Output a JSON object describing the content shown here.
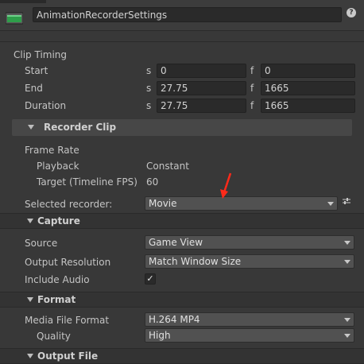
{
  "header": {
    "object_name": "AnimationRecorderSettings",
    "help_glyph": "?"
  },
  "clip_timing": {
    "title": "Clip Timing",
    "rows": [
      {
        "label": "Start",
        "s_prefix": "s",
        "s_value": "0",
        "f_prefix": "f",
        "f_value": "0"
      },
      {
        "label": "End",
        "s_prefix": "s",
        "s_value": "27.75",
        "f_prefix": "f",
        "f_value": "1665"
      },
      {
        "label": "Duration",
        "s_prefix": "s",
        "s_value": "27.75",
        "f_prefix": "f",
        "f_value": "1665"
      }
    ]
  },
  "recorder_clip": {
    "title": "Recorder Clip",
    "frame_rate_label": "Frame Rate",
    "playback_label": "Playback",
    "playback_value": "Constant",
    "target_label": "Target (Timeline FPS)",
    "target_value": "60",
    "selected_recorder_label": "Selected recorder:",
    "selected_recorder_value": "Movie"
  },
  "capture": {
    "title": "Capture",
    "source_label": "Source",
    "source_value": "Game View",
    "resolution_label": "Output Resolution",
    "resolution_value": "Match Window Size",
    "audio_label": "Include Audio",
    "audio_checked": true,
    "check_glyph": "✓"
  },
  "format": {
    "title": "Format",
    "media_label": "Media File Format",
    "media_value": "H.264 MP4",
    "quality_label": "Quality",
    "quality_value": "High"
  },
  "output_file": {
    "title": "Output File"
  },
  "colors": {
    "background": "#383838",
    "accent_arrow": "#ff2a1a",
    "icon_green": "#2e9e4a"
  }
}
